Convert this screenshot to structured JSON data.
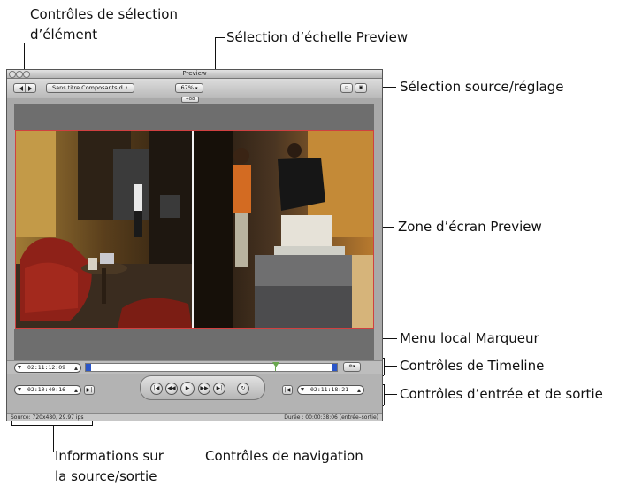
{
  "callouts": {
    "item_selection": "Contrôles de sélection d’élément",
    "item_selection_line1": "Contrôles de sélection",
    "item_selection_line2": "d’élément",
    "scale_selection": "Sélection d’échelle Preview",
    "source_setting": "Sélection source/réglage",
    "screen_area": "Zone d’écran Preview",
    "marker_menu": "Menu local Marqueur",
    "timeline_controls": "Contrôles de Timeline",
    "in_out_controls": "Contrôles d’entrée et de sortie",
    "source_info_line1": "Informations sur",
    "source_info_line2": "la source/sortie",
    "nav_controls": "Contrôles de navigation"
  },
  "window": {
    "title": "Preview",
    "item_popup": "Sans titre Composants d",
    "zoom": "67%",
    "scrubber_pos": "+88",
    "timeline_timecode": "02:11:12:09",
    "in_timecode": "02:10:40:16",
    "out_timecode": "02:11:18:21",
    "status_left": "Source: 720x480, 29.97 ips",
    "status_right": "Durée : 00:00:38:06 (entrée–sortie)"
  },
  "colors": {
    "window_bg": "#a9a9a9",
    "screen_border": "#d04040",
    "marker_green": "#6aa84f",
    "marker_blue": "#2a55c8"
  }
}
